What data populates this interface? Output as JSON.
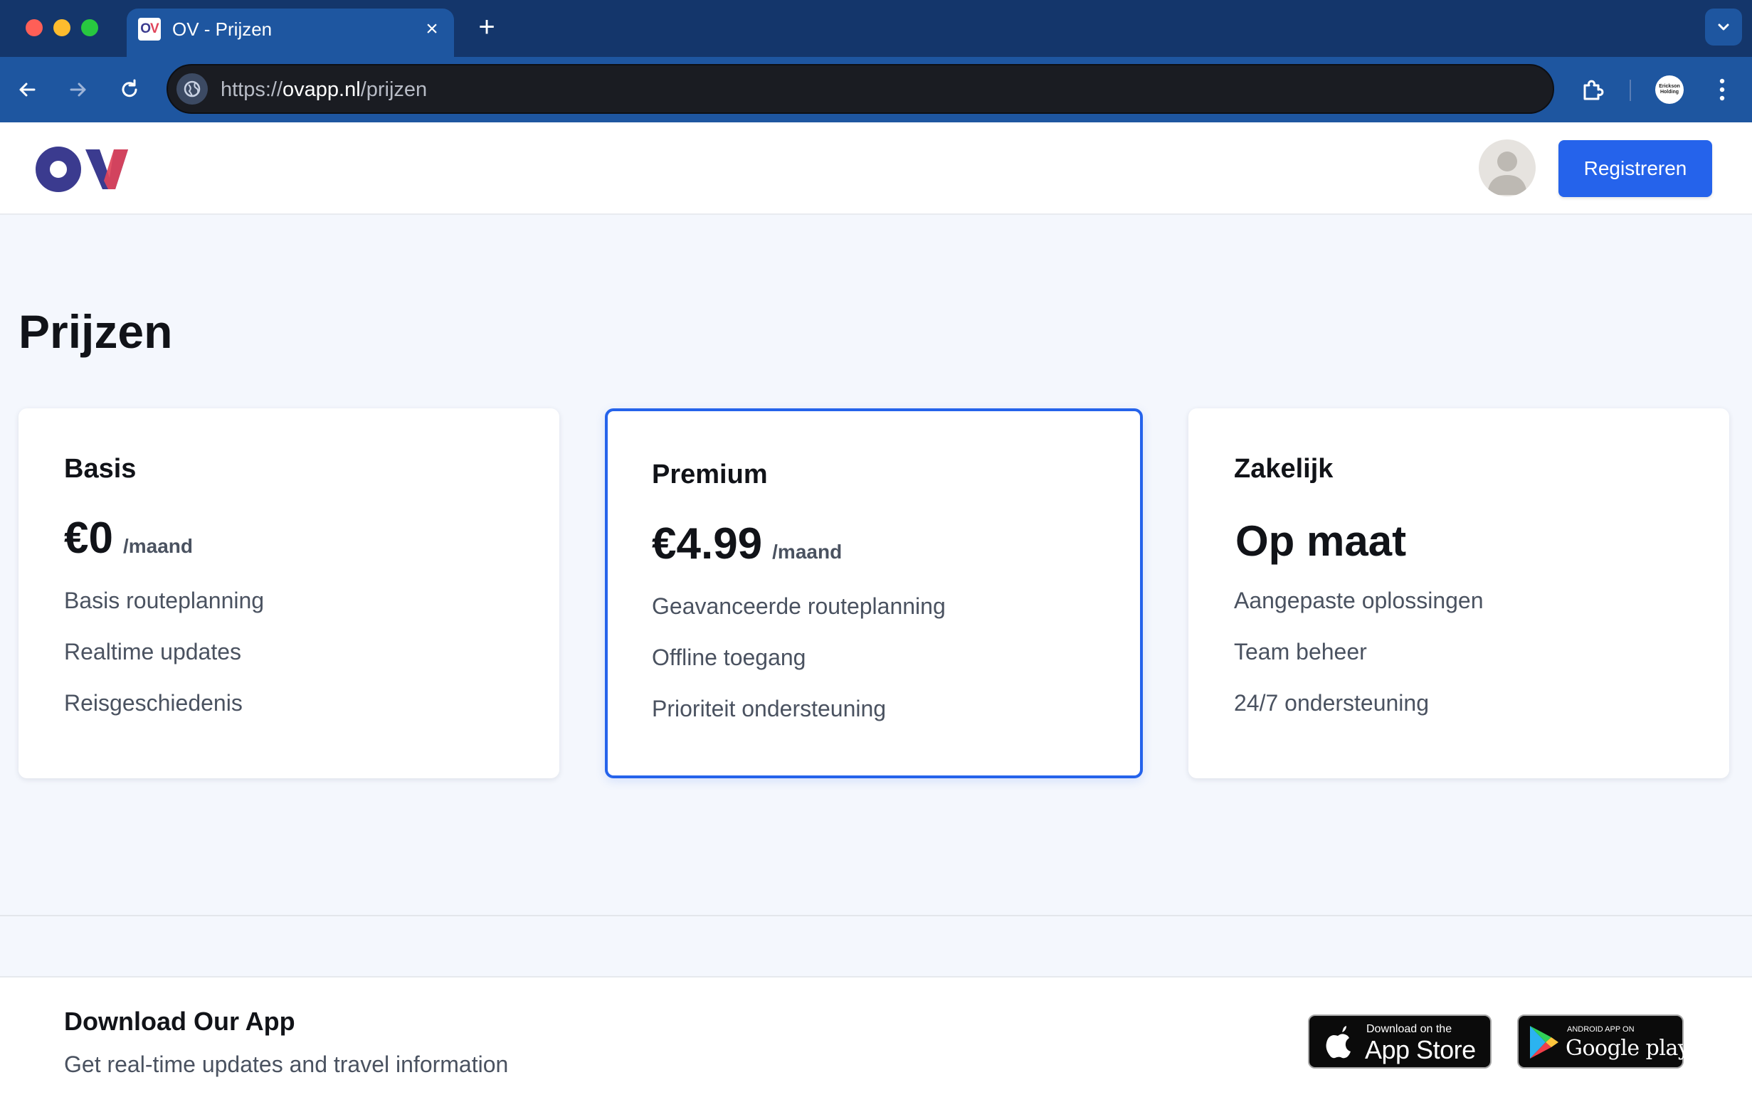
{
  "browser": {
    "tab_title": "OV - Prijzen",
    "favicon_text_1": "O",
    "favicon_text_2": "V",
    "new_tab_label": "+",
    "close_tab_label": "×",
    "url_scheme": "https://",
    "url_host": "ovapp.nl",
    "url_path": "/prijzen",
    "profile_text": "Erickson Holding"
  },
  "header": {
    "logo_text": "OV",
    "register_label": "Registreren"
  },
  "page_title": "Prijzen",
  "plans": [
    {
      "name": "Basis",
      "price": "€0",
      "period": "/maand",
      "features": [
        "Basis routeplanning",
        "Realtime updates",
        "Reisgeschiedenis"
      ]
    },
    {
      "name": "Premium",
      "price": "€4.99",
      "period": "/maand",
      "features": [
        "Geavanceerde routeplanning",
        "Offline toegang",
        "Prioriteit ondersteuning"
      ]
    },
    {
      "name": "Zakelijk",
      "price": "Op maat",
      "features": [
        "Aangepaste oplossingen",
        "Team beheer",
        "24/7 ondersteuning"
      ]
    }
  ],
  "footer": {
    "title": "Download Our App",
    "subtitle": "Get real-time updates and travel information",
    "app_store_small": "Download on the",
    "app_store_big": "App Store",
    "google_play_small": "ANDROID APP ON",
    "google_play_big": "Google play"
  },
  "colors": {
    "accent": "#2563eb",
    "chrome_tab_bar": "#14366b",
    "chrome_toolbar": "#1e56a0",
    "logo_primary": "#3b3b8f",
    "logo_secondary": "#e0445a"
  },
  "icons": {
    "back": "arrow-left-icon",
    "forward": "arrow-right-icon",
    "reload": "reload-icon",
    "site": "globe-icon",
    "extensions": "puzzle-icon",
    "menu": "kebab-menu-icon",
    "tab_list": "chevron-down-icon",
    "avatar": "user-avatar-icon",
    "apple": "apple-icon",
    "play": "play-triangle-icon"
  }
}
